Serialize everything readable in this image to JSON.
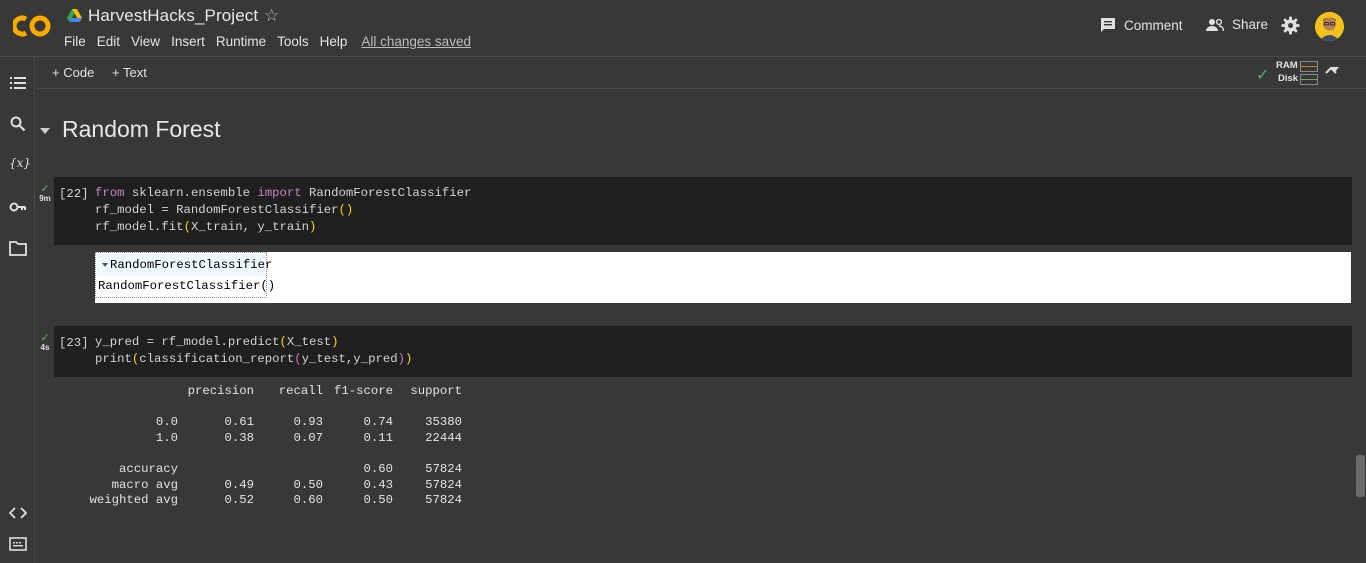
{
  "app": {
    "title": "HarvestHacks_Project",
    "menu": [
      "File",
      "Edit",
      "View",
      "Insert",
      "Runtime",
      "Tools",
      "Help"
    ],
    "save_status": "All changes saved",
    "comment_label": "Comment",
    "share_label": "Share",
    "accent_color": "#f9ab00"
  },
  "toolbar": {
    "add_code": "Code",
    "add_text": "Text",
    "ram_label": "RAM",
    "disk_label": "Disk"
  },
  "rail_icons": [
    "table-of-contents-icon",
    "search-icon",
    "variables-icon",
    "secrets-key-icon",
    "files-folder-icon",
    "code-snippets-icon",
    "terminal-icon"
  ],
  "notebook": {
    "section_title": "Random Forest",
    "cell1": {
      "exec_count": "[22]",
      "exec_time": "9m",
      "output_header": "RandomForestClassifier",
      "output_body": "RandomForestClassifier()"
    },
    "cell2": {
      "exec_count": "[23]",
      "exec_time": "4s"
    },
    "report": {
      "headers": [
        "",
        "precision",
        "recall",
        "f1-score",
        "support"
      ],
      "rows": [
        [
          "0.0",
          "0.61",
          "0.93",
          "0.74",
          "35380"
        ],
        [
          "1.0",
          "0.38",
          "0.07",
          "0.11",
          "22444"
        ],
        [
          "",
          "",
          "",
          "",
          ""
        ],
        [
          "accuracy",
          "",
          "",
          "0.60",
          "57824"
        ],
        [
          "macro avg",
          "0.49",
          "0.50",
          "0.43",
          "57824"
        ],
        [
          "weighted avg",
          "0.52",
          "0.60",
          "0.50",
          "57824"
        ]
      ]
    }
  }
}
